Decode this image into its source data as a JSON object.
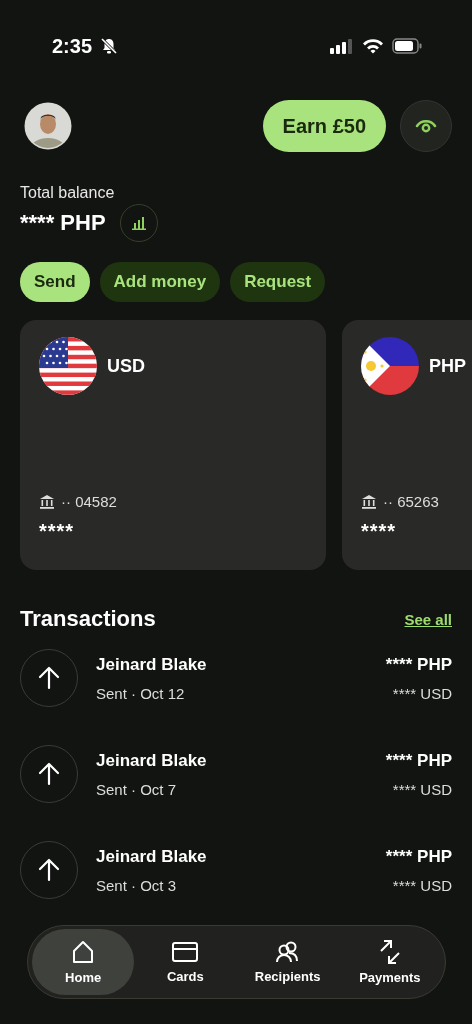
{
  "status_bar": {
    "time": "2:35"
  },
  "header": {
    "earn_button": "Earn £50"
  },
  "balance": {
    "label": "Total balance",
    "amount": "**** PHP"
  },
  "actions": [
    {
      "label": "Send",
      "kind": "primary"
    },
    {
      "label": "Add money",
      "kind": "secondary"
    },
    {
      "label": "Request",
      "kind": "secondary"
    }
  ],
  "accounts": [
    {
      "currency": "USD",
      "kind": "us",
      "account": "·· 04582",
      "balance": "****"
    },
    {
      "currency": "PHP",
      "kind": "ph",
      "account": "·· 65263",
      "balance": "****"
    }
  ],
  "transactions": {
    "title": "Transactions",
    "see_all": "See all",
    "items": [
      {
        "name": "Jeinard Blake",
        "detail": "Sent · Oct 12",
        "amount": "**** PHP",
        "converted": "**** USD"
      },
      {
        "name": "Jeinard Blake",
        "detail": "Sent · Oct 7",
        "amount": "**** PHP",
        "converted": "**** USD"
      },
      {
        "name": "Jeinard Blake",
        "detail": "Sent · Oct 3",
        "amount": "**** PHP",
        "converted": "**** USD"
      }
    ]
  },
  "nav": [
    {
      "label": "Home",
      "kind": "home",
      "selected": true
    },
    {
      "label": "Cards",
      "kind": "card",
      "selected": false
    },
    {
      "label": "Recipients",
      "kind": "people",
      "selected": false
    },
    {
      "label": "Payments",
      "kind": "swap",
      "selected": false
    }
  ]
}
